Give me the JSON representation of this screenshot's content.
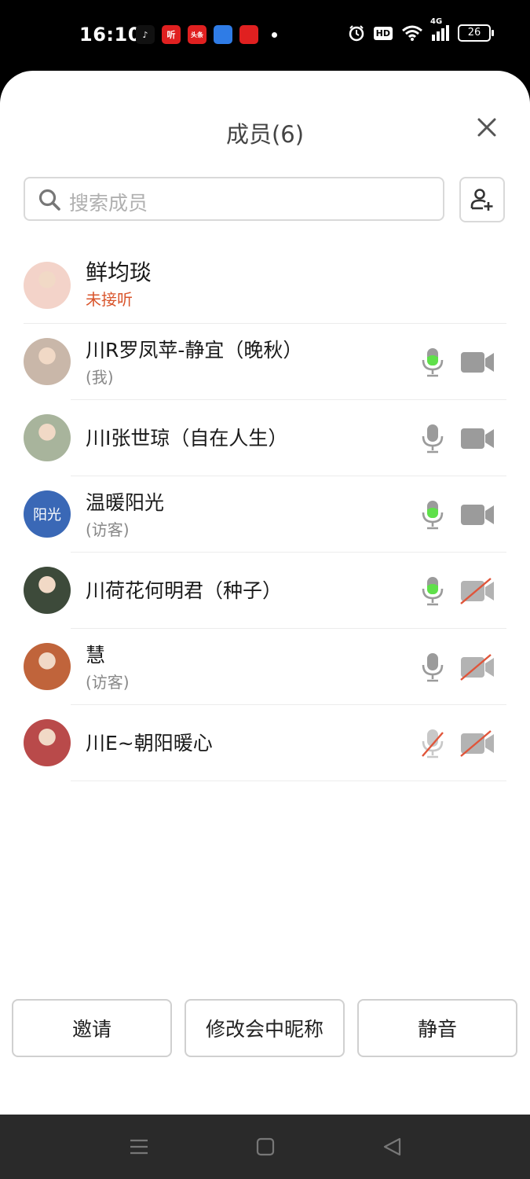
{
  "status_bar": {
    "time": "16:10",
    "app_icons": [
      {
        "name": "tiktok-icon",
        "label": "♪",
        "color": "#111111"
      },
      {
        "name": "ting-app-icon",
        "label": "听",
        "color": "#e02020"
      },
      {
        "name": "toutiao-app-icon",
        "label": "头条",
        "color": "#e02020"
      },
      {
        "name": "blue-app-icon",
        "label": "",
        "color": "#2f7ce6"
      },
      {
        "name": "red-app-icon",
        "label": "",
        "color": "#e02020"
      }
    ],
    "hd": "HD",
    "network": "4G",
    "battery": "26"
  },
  "sheet": {
    "title": "成员(6)",
    "search_placeholder": "搜索成员"
  },
  "members": [
    {
      "name": "鲜均琰",
      "sub": "未接听",
      "sub_style": "red",
      "avatar_type": "photo",
      "avatar_color": "#f3d3c9",
      "mic": "none",
      "cam": "none"
    },
    {
      "name": "川R罗凤苹-静宜（晚秋）",
      "sub": "(我)",
      "sub_style": "gray",
      "avatar_type": "photo",
      "avatar_color": "#c9b7a9",
      "mic": "active",
      "cam": "on"
    },
    {
      "name": "川I张世琼（自在人生）",
      "sub": "",
      "sub_style": "gray",
      "avatar_type": "photo",
      "avatar_color": "#a8b49c",
      "mic": "idle",
      "cam": "on"
    },
    {
      "name": "温暖阳光",
      "sub": "(访客)",
      "sub_style": "gray",
      "avatar_type": "text",
      "avatar_text": "阳光",
      "avatar_color": "#3a68b6",
      "mic": "active",
      "cam": "on"
    },
    {
      "name": "川荷花何明君（种子）",
      "sub": "",
      "sub_style": "gray",
      "avatar_type": "photo",
      "avatar_color": "#3d4a3a",
      "mic": "active",
      "cam": "off"
    },
    {
      "name": "慧",
      "sub": "(访客)",
      "sub_style": "gray",
      "avatar_type": "photo",
      "avatar_color": "#c0643b",
      "mic": "idle",
      "cam": "off"
    },
    {
      "name": "川E~朝阳暖心",
      "sub": "",
      "sub_style": "gray",
      "avatar_type": "photo",
      "avatar_color": "#b94a4a",
      "mic": "muted",
      "cam": "off"
    }
  ],
  "bottom_buttons": {
    "invite": "邀请",
    "rename": "修改会中昵称",
    "mute": "静音"
  },
  "colors": {
    "mic_active": "#5fe04a",
    "icon_gray": "#9b9b9b",
    "strike_red": "#e0553a"
  }
}
